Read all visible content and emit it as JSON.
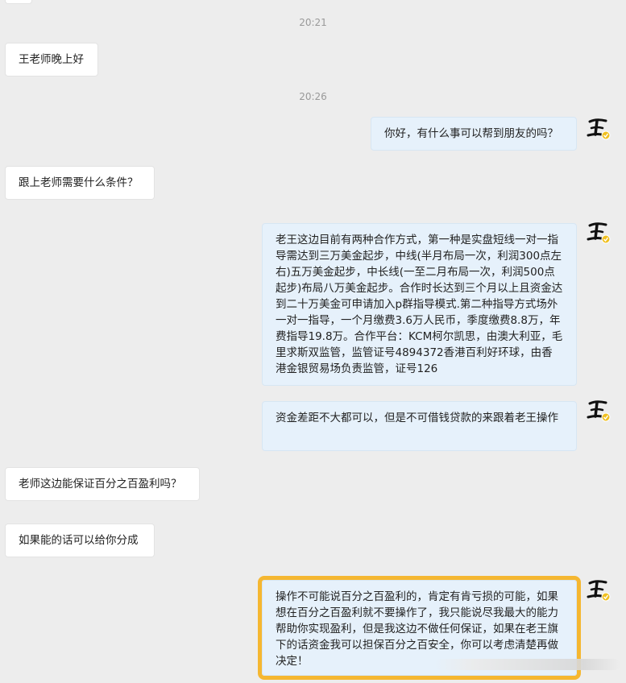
{
  "timestamps": [
    "20:21",
    "20:26"
  ],
  "messages": [
    {
      "side": "left",
      "text": "王老师晚上好"
    },
    {
      "side": "right",
      "text": "你好，有什么事可以帮到朋友的吗？"
    },
    {
      "side": "left",
      "text": "跟上老师需要什么条件？"
    },
    {
      "side": "right",
      "text": "老王这边目前有两种合作方式，第一种是实盘短线一对一指导需达到三万美金起步，中线(半月布局一次，利润300点左右)五万美金起步，中长线(一至二月布局一次，利润500点起步)布局八万美金起步。合作时长达到三个月以上且资金达到二十万美金可申请加入p群指导模式.第二种指导方式场外一对一指导，一个月缴费3.6万人民币，季度缴费8.8万，年费指导19.8万。合作平台：KCM柯尔凯思，由澳大利亚，毛里求斯双监管，监管证号4894372香港百利好环球，由香港金银贸易场负责监管，证号126"
    },
    {
      "side": "right",
      "text": "资金差距不大都可以，但是不可借钱贷款的来跟着老王操作"
    },
    {
      "side": "left",
      "text": "老师这边能保证百分之百盈利吗？"
    },
    {
      "side": "left",
      "text": "如果能的话可以给你分成"
    },
    {
      "side": "right",
      "text": "操作不可能说百分之百盈利的，肯定有肯亏损的可能，如果想在百分之百盈利就不要操作了，我只能说尽我最大的能力帮助你实现盈利，但是我这边不做任何保证，如果在老王旗下的话资金我可以担保百分之百安全，你可以考虑清楚再做决定！"
    }
  ],
  "avatar": {
    "icon": "calligraphy-avatar",
    "badge_color": "#f0c020"
  },
  "highlight_color": "#f5b731"
}
